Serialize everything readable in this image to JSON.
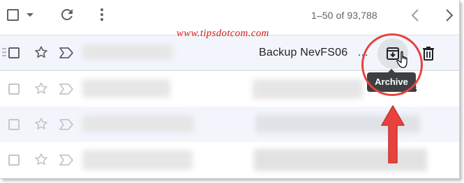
{
  "toolbar": {
    "select_all_icon": "checkbox-icon",
    "select_menu_icon": "caret-down-icon",
    "refresh_icon": "refresh-icon",
    "more_icon": "more-vert-icon"
  },
  "pagination": {
    "range_text": "1–50 of 93,788",
    "prev_icon": "chevron-left-icon",
    "next_icon": "chevron-right-icon"
  },
  "watermark": "www.tipsdotcom.com",
  "rows": [
    {
      "subject": "Backup NevFS06",
      "subject_ellipsis": "…",
      "hovered": true
    },
    {
      "partial_text": "kup s"
    },
    {
      "partial_text": ""
    },
    {
      "partial_text": ""
    }
  ],
  "hover_actions": {
    "archive_icon": "archive-icon",
    "delete_icon": "trash-icon",
    "cursor_icon": "hand-pointer-icon"
  },
  "tooltip": {
    "label": "Archive"
  },
  "colors": {
    "accent_red": "#e8423f",
    "hover_row_bg": "#f2f6fc",
    "tooltip_bg": "#3c4043",
    "icon_gray": "#5f6368"
  }
}
